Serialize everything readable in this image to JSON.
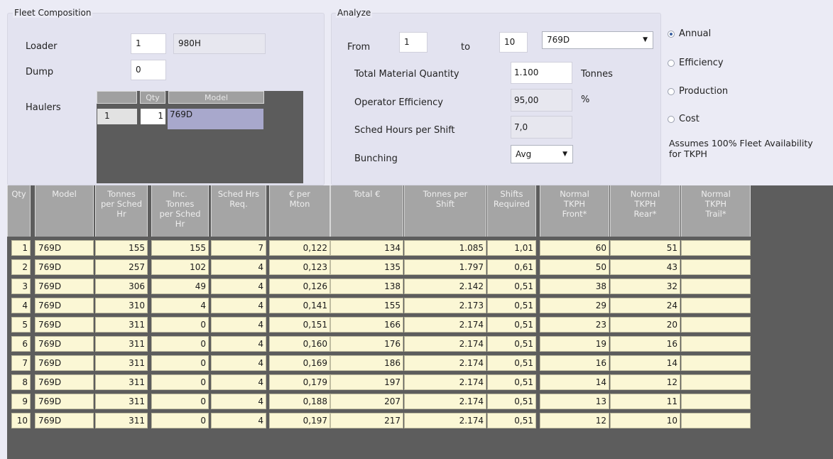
{
  "fleet": {
    "title": "Fleet Composition",
    "loader_label": "Loader",
    "loader_qty": "1",
    "loader_model": "980H",
    "dump_label": "Dump",
    "dump_value": "0",
    "haulers_label": "Haulers",
    "haulers_grid": {
      "headers": [
        "",
        "Qty",
        "Model"
      ],
      "row": {
        "index": "1",
        "qty": "1",
        "model": "769D"
      }
    }
  },
  "analyze": {
    "title": "Analyze",
    "from_label": "From",
    "from_value": "1",
    "to_label": "to",
    "to_value": "10",
    "model_select": "769D",
    "total_material_label": "Total Material Quantity",
    "total_material_value": "1.100",
    "total_material_unit": "Tonnes",
    "operator_eff_label": "Operator Efficiency",
    "operator_eff_value": "95,00",
    "operator_eff_unit": "%",
    "sched_hours_label": "Sched Hours per Shift",
    "sched_hours_value": "7,0",
    "bunching_label": "Bunching",
    "bunching_value": "Avg"
  },
  "options": {
    "radios": [
      {
        "label": "Annual",
        "selected": true
      },
      {
        "label": "Efficiency",
        "selected": false
      },
      {
        "label": "Production",
        "selected": false
      },
      {
        "label": "Cost",
        "selected": false
      }
    ],
    "note_line1": "Assumes 100% Fleet Availability",
    "note_line2": "for TKPH"
  },
  "table": {
    "headers": [
      "Qty",
      "Model",
      "Tonnes\nper Sched\nHr",
      "Inc.\nTonnes\nper Sched\nHr",
      "Sched Hrs\nReq.",
      "€ per\nMton",
      "Total €",
      "Tonnes per\nShift",
      "Shifts\nRequired",
      "Normal\nTKPH\nFront*",
      "Normal\nTKPH\nRear*",
      "Normal\nTKPH\nTrail*"
    ],
    "rows": [
      [
        "1",
        "769D",
        "155",
        "155",
        "7",
        "0,122",
        "134",
        "1.085",
        "1,01",
        "60",
        "51",
        ""
      ],
      [
        "2",
        "769D",
        "257",
        "102",
        "4",
        "0,123",
        "135",
        "1.797",
        "0,61",
        "50",
        "43",
        ""
      ],
      [
        "3",
        "769D",
        "306",
        "49",
        "4",
        "0,126",
        "138",
        "2.142",
        "0,51",
        "38",
        "32",
        ""
      ],
      [
        "4",
        "769D",
        "310",
        "4",
        "4",
        "0,141",
        "155",
        "2.173",
        "0,51",
        "29",
        "24",
        ""
      ],
      [
        "5",
        "769D",
        "311",
        "0",
        "4",
        "0,151",
        "166",
        "2.174",
        "0,51",
        "23",
        "20",
        ""
      ],
      [
        "6",
        "769D",
        "311",
        "0",
        "4",
        "0,160",
        "176",
        "2.174",
        "0,51",
        "19",
        "16",
        ""
      ],
      [
        "7",
        "769D",
        "311",
        "0",
        "4",
        "0,169",
        "186",
        "2.174",
        "0,51",
        "16",
        "14",
        ""
      ],
      [
        "8",
        "769D",
        "311",
        "0",
        "4",
        "0,179",
        "197",
        "2.174",
        "0,51",
        "14",
        "12",
        ""
      ],
      [
        "9",
        "769D",
        "311",
        "0",
        "4",
        "0,188",
        "207",
        "2.174",
        "0,51",
        "13",
        "11",
        ""
      ],
      [
        "10",
        "769D",
        "311",
        "0",
        "4",
        "0,197",
        "217",
        "2.174",
        "0,51",
        "12",
        "10",
        ""
      ]
    ]
  }
}
